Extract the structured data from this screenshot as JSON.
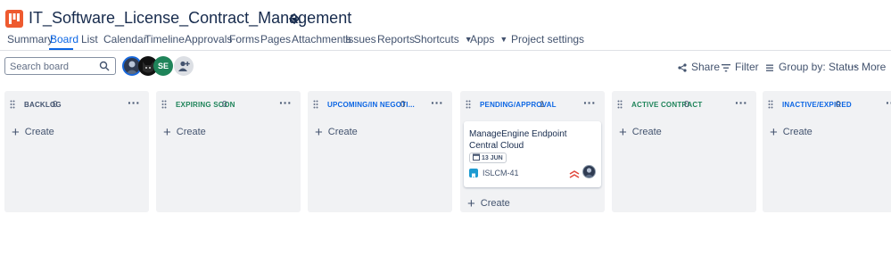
{
  "project": {
    "title": "IT_Software_License_Contract_Management",
    "icon": "project-board-icon",
    "brand_color": "#ee5a2f"
  },
  "nav": {
    "items": [
      "Summary",
      "Board",
      "List",
      "Calendar",
      "Timeline",
      "Approvals",
      "Forms",
      "Pages",
      "Attachments",
      "Issues",
      "Reports",
      "Shortcuts",
      "Apps",
      "Project settings"
    ],
    "active": "Board",
    "accent": "#0c66e4"
  },
  "toolbar": {
    "search_placeholder": "Search board",
    "avatar_initials": "SE",
    "share_label": "Share",
    "filter_label": "Filter",
    "group_label": "Group by: Status",
    "more_label": "More"
  },
  "columns": [
    {
      "title": "BACKLOG",
      "count": "0",
      "create_label": "Create"
    },
    {
      "title": "EXPIRING SOON",
      "count": "0",
      "create_label": "Create"
    },
    {
      "title": "UPCOMING/IN NEGOTI...",
      "count": "0",
      "create_label": "Create"
    },
    {
      "title": "PENDING/APPROVAL",
      "count": "1",
      "create_label": "Create"
    },
    {
      "title": "ACTIVE CONTRACT",
      "count": "0",
      "create_label": "Create"
    },
    {
      "title": "INACTIVE/EXPIRED",
      "count": "0",
      "create_label": "Create"
    }
  ],
  "card": {
    "title": "ManageEngine Endpoint Central Cloud",
    "due_date": "13 JUN",
    "issue_key": "ISLCM-41",
    "priority": "highest",
    "issue_type_color": "#1d9bd1"
  }
}
